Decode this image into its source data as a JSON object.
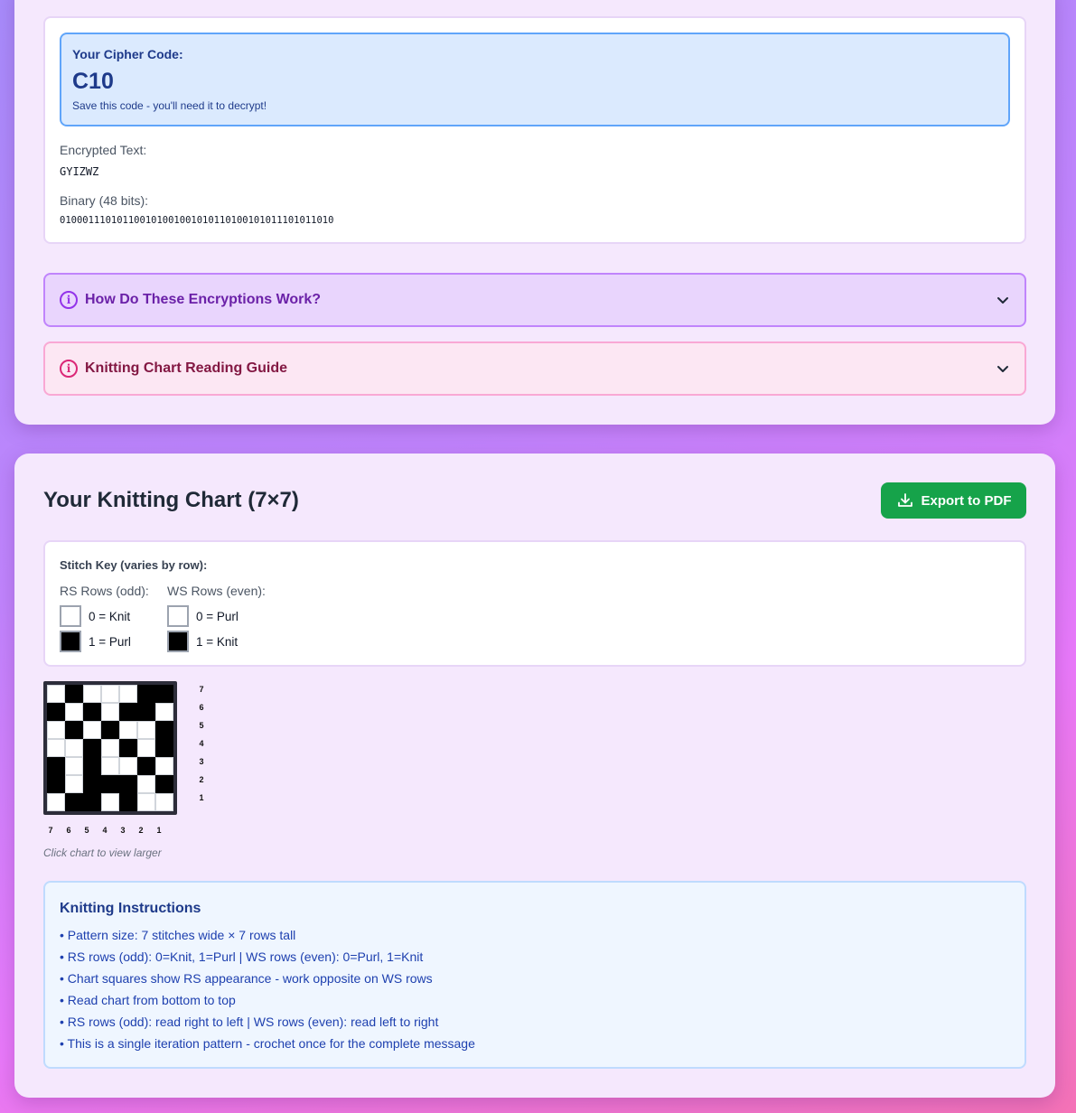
{
  "result": {
    "cipher_label": "Your Cipher Code:",
    "cipher_code": "C10",
    "cipher_note": "Save this code - you'll need it to decrypt!",
    "encrypted_label": "Encrypted Text:",
    "encrypted_text": "GYIZWZ",
    "binary_label": "Binary (48 bits):",
    "binary_text": "010001110101100101001001010110100101011101011010"
  },
  "accordions": [
    {
      "title": "How Do These Encryptions Work?",
      "icon": "info-icon",
      "expanded": false
    },
    {
      "title": "Knitting Chart Reading Guide",
      "icon": "info-icon",
      "expanded": false
    }
  ],
  "chart_section": {
    "title": "Your Knitting Chart (7×7)",
    "export_label": "Export to PDF",
    "export_icon": "download-icon",
    "export_color": "#16a34a"
  },
  "stitch_key": {
    "title": "Stitch Key (varies by row):",
    "rs": {
      "heading": "RS Rows (odd):",
      "zero": "0 = Knit",
      "one": "1 = Purl"
    },
    "ws": {
      "heading": "WS Rows (even):",
      "zero": "0 = Purl",
      "one": "1 = Knit"
    }
  },
  "grid": {
    "rows": [
      [
        0,
        1,
        0,
        0,
        0,
        1,
        1
      ],
      [
        1,
        0,
        1,
        0,
        1,
        1,
        0
      ],
      [
        0,
        1,
        0,
        1,
        0,
        0,
        1
      ],
      [
        0,
        0,
        1,
        0,
        1,
        0,
        1
      ],
      [
        1,
        0,
        1,
        0,
        0,
        1,
        0
      ],
      [
        1,
        0,
        1,
        1,
        1,
        0,
        1
      ],
      [
        0,
        1,
        1,
        0,
        1,
        0,
        0
      ]
    ],
    "row_labels": [
      "7",
      "6",
      "5",
      "4",
      "3",
      "2",
      "1"
    ],
    "col_labels": [
      "7",
      "6",
      "5",
      "4",
      "3",
      "2",
      "1"
    ],
    "hint": "Click chart to view larger"
  },
  "instructions": {
    "title": "Knitting Instructions",
    "items": [
      "• Pattern size: 7 stitches wide × 7 rows tall",
      "• RS rows (odd): 0=Knit, 1=Purl | WS rows (even): 0=Purl, 1=Knit",
      "• Chart squares show RS appearance - work opposite on WS rows",
      "• Read chart from bottom to top",
      "• RS rows (odd): read right to left | WS rows (even): read left to right",
      "• This is a single iteration pattern - crochet once for the complete message"
    ]
  }
}
